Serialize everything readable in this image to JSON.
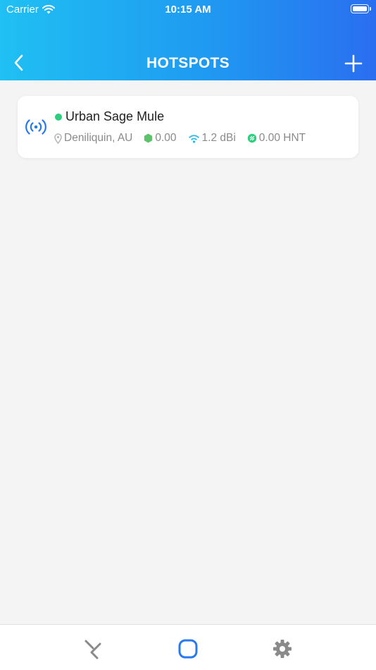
{
  "status_bar": {
    "carrier": "Carrier",
    "time": "10:15 AM"
  },
  "nav": {
    "title": "HOTSPOTS",
    "back_icon": "chevron-left-icon",
    "add_icon": "plus-icon"
  },
  "hotspots": [
    {
      "name": "Urban Sage Mule",
      "status": "online",
      "status_color": "#2ccf7f",
      "location": "Deniliquin, AU",
      "score": "0.00",
      "gain": "1.2 dBi",
      "earnings": "0.00 HNT"
    }
  ],
  "tabs": [
    {
      "icon": "helium-logo-icon",
      "active": false
    },
    {
      "icon": "hotspot-square-icon",
      "active": true
    },
    {
      "icon": "gear-icon",
      "active": false
    }
  ],
  "colors": {
    "header_start": "#1fc0f3",
    "header_end": "#2a6ef0",
    "accent": "#2878f0",
    "online": "#2ccf7f",
    "score": "#5cc36a",
    "wifi": "#28b7e8",
    "hnt": "#2ccf7f"
  }
}
